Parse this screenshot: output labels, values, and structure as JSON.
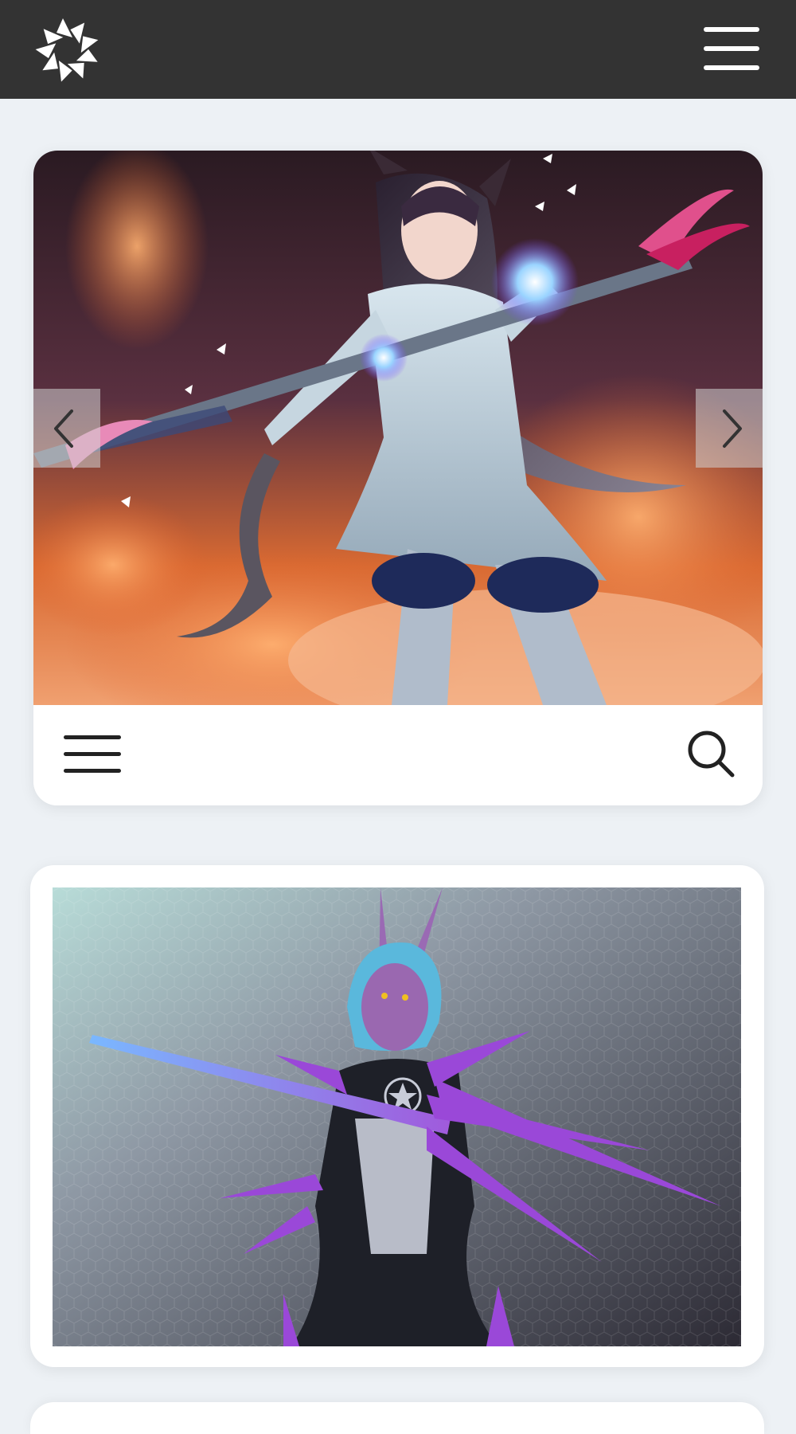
{
  "header": {
    "logo_icon": "pinwheel-logo-icon",
    "menu_icon": "hamburger-menu-icon"
  },
  "featured_slider": {
    "prev_icon": "chevron-left-icon",
    "next_icon": "chevron-right-icon",
    "image_subject": "catgirl-mage-with-crystal-staff",
    "toolbar": {
      "menu_icon": "hamburger-menu-icon",
      "search_icon": "search-icon"
    }
  },
  "gallery": {
    "items": [
      {
        "image_subject": "purple-horned-alien-warrior"
      }
    ]
  },
  "colors": {
    "topbar": "#333333",
    "page_background": "#edf1f5",
    "card_background": "#ffffff",
    "icon_dark": "#222222"
  }
}
